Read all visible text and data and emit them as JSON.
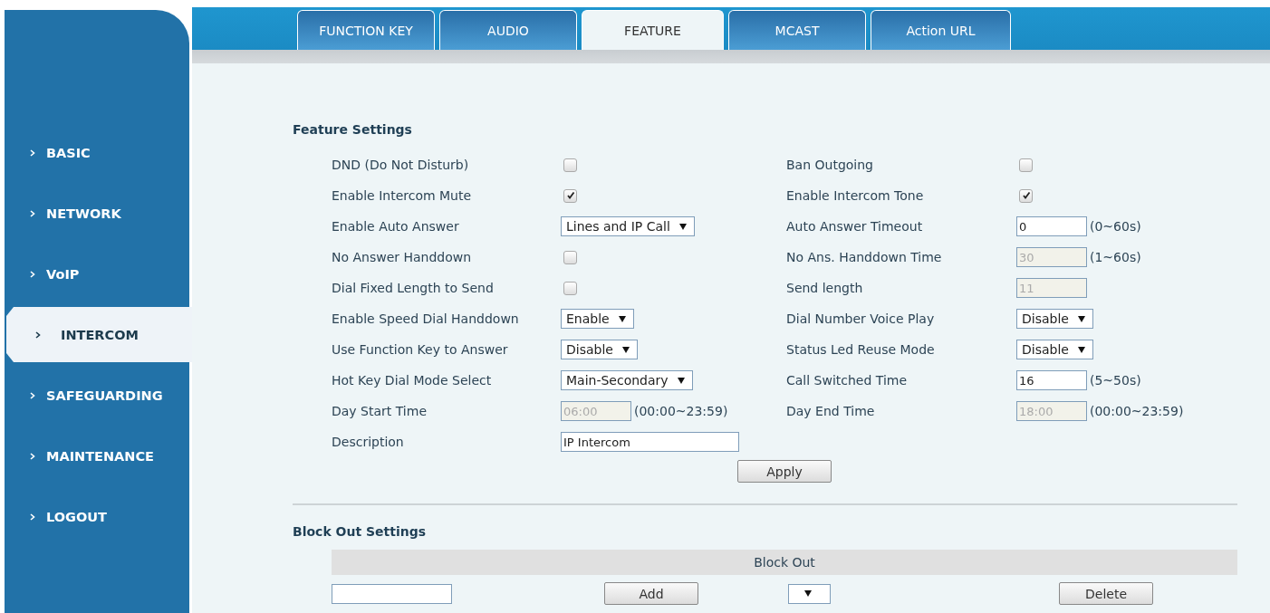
{
  "tabs": [
    {
      "label": "FUNCTION KEY",
      "selected": false
    },
    {
      "label": "AUDIO",
      "selected": false
    },
    {
      "label": "FEATURE",
      "selected": true
    },
    {
      "label": "MCAST",
      "selected": false
    },
    {
      "label": "Action URL",
      "selected": false
    }
  ],
  "sidebar": {
    "items": [
      {
        "label": "BASIC",
        "selected": false
      },
      {
        "label": "NETWORK",
        "selected": false
      },
      {
        "label": "VoIP",
        "selected": false
      },
      {
        "label": "INTERCOM",
        "selected": true
      },
      {
        "label": "SAFEGUARDING",
        "selected": false
      },
      {
        "label": "MAINTENANCE",
        "selected": false
      },
      {
        "label": "LOGOUT",
        "selected": false
      }
    ]
  },
  "feature_settings": {
    "title": "Feature Settings",
    "rows": [
      {
        "left": {
          "label": "DND (Do Not Disturb)",
          "kind": "checkbox",
          "checked": false
        },
        "right": {
          "label": "Ban Outgoing",
          "kind": "checkbox",
          "checked": false
        }
      },
      {
        "left": {
          "label": "Enable Intercom Mute",
          "kind": "checkbox",
          "checked": true
        },
        "right": {
          "label": "Enable Intercom Tone",
          "kind": "checkbox",
          "checked": true
        }
      },
      {
        "left": {
          "label": "Enable Auto Answer",
          "kind": "select",
          "value": "Lines and IP Call"
        },
        "right": {
          "label": "Auto Answer Timeout",
          "kind": "input",
          "value": "0",
          "disabled": false,
          "hint": "(0~60s)"
        }
      },
      {
        "left": {
          "label": "No Answer Handdown",
          "kind": "checkbox",
          "checked": false
        },
        "right": {
          "label": "No Ans. Handdown Time",
          "kind": "input",
          "value": "30",
          "disabled": true,
          "hint": "(1~60s)"
        }
      },
      {
        "left": {
          "label": "Dial Fixed Length to Send",
          "kind": "checkbox",
          "checked": false
        },
        "right": {
          "label": "Send length",
          "kind": "input",
          "value": "11",
          "disabled": true
        }
      },
      {
        "left": {
          "label": "Enable Speed Dial Handdown",
          "kind": "select",
          "value": "Enable"
        },
        "right": {
          "label": "Dial Number Voice Play",
          "kind": "select",
          "value": "Disable"
        }
      },
      {
        "left": {
          "label": "Use Function Key to Answer",
          "kind": "select",
          "value": "Disable"
        },
        "right": {
          "label": "Status Led Reuse Mode",
          "kind": "select",
          "value": "Disable"
        }
      },
      {
        "left": {
          "label": "Hot Key Dial Mode Select",
          "kind": "select",
          "value": "Main-Secondary"
        },
        "right": {
          "label": "Call Switched Time",
          "kind": "input",
          "value": "16",
          "disabled": false,
          "hint": "(5~50s)"
        }
      },
      {
        "left": {
          "label": "Day Start Time",
          "kind": "input",
          "value": "06:00",
          "disabled": true,
          "hint": "(00:00~23:59)"
        },
        "right": {
          "label": "Day End Time",
          "kind": "input",
          "value": "18:00",
          "disabled": true,
          "hint": "(00:00~23:59)"
        }
      },
      {
        "left": {
          "label": "Description",
          "kind": "wide_input",
          "value": "IP Intercom",
          "disabled": false
        }
      }
    ],
    "apply_button": "Apply"
  },
  "block_out_settings": {
    "title": "Block Out Settings",
    "header": "Block Out",
    "add_button": "Add",
    "delete_button": "Delete"
  }
}
